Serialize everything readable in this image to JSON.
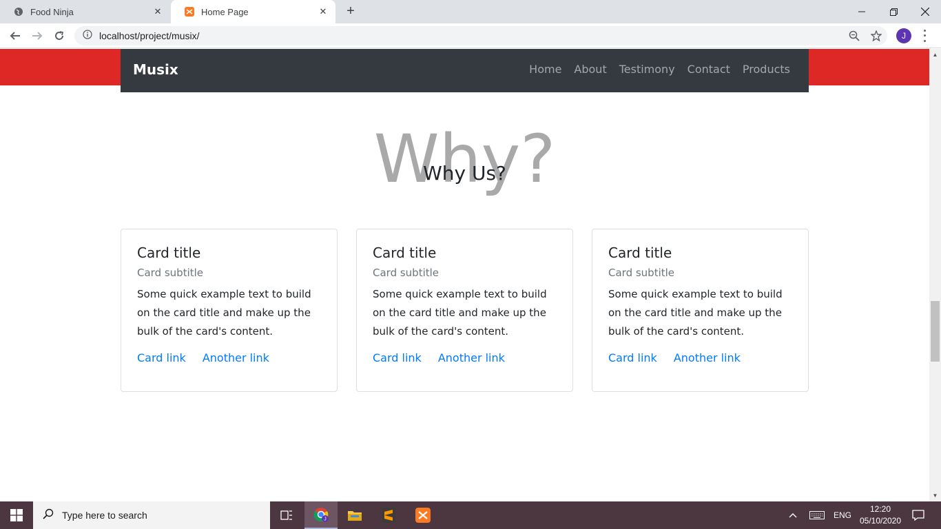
{
  "browser": {
    "tabs": [
      {
        "title": "Food Ninja"
      },
      {
        "title": "Home Page"
      }
    ],
    "address": "localhost/project/musix/",
    "profile_initial": "J"
  },
  "site": {
    "brand": "Musix",
    "nav": [
      "Home",
      "About",
      "Testimony",
      "Contact",
      "Products"
    ],
    "hero_bg_text": "Why?",
    "section_title": "Why Us?",
    "cards": [
      {
        "title": "Card title",
        "subtitle": "Card subtitle",
        "text": "Some quick example text to build on the card title and make up the bulk of the card's content.",
        "link1": "Card link",
        "link2": "Another link"
      },
      {
        "title": "Card title",
        "subtitle": "Card subtitle",
        "text": "Some quick example text to build on the card title and make up the bulk of the card's content.",
        "link1": "Card link",
        "link2": "Another link"
      },
      {
        "title": "Card title",
        "subtitle": "Card subtitle",
        "text": "Some quick example text to build on the card title and make up the bulk of the card's content.",
        "link1": "Card link",
        "link2": "Another link"
      }
    ],
    "colors": {
      "red_band": "#de2826",
      "navbar": "#343a40",
      "link": "#007bff"
    }
  },
  "taskbar": {
    "search_placeholder": "Type here to search",
    "language": "ENG",
    "time": "12:20",
    "date": "05/10/2020"
  }
}
